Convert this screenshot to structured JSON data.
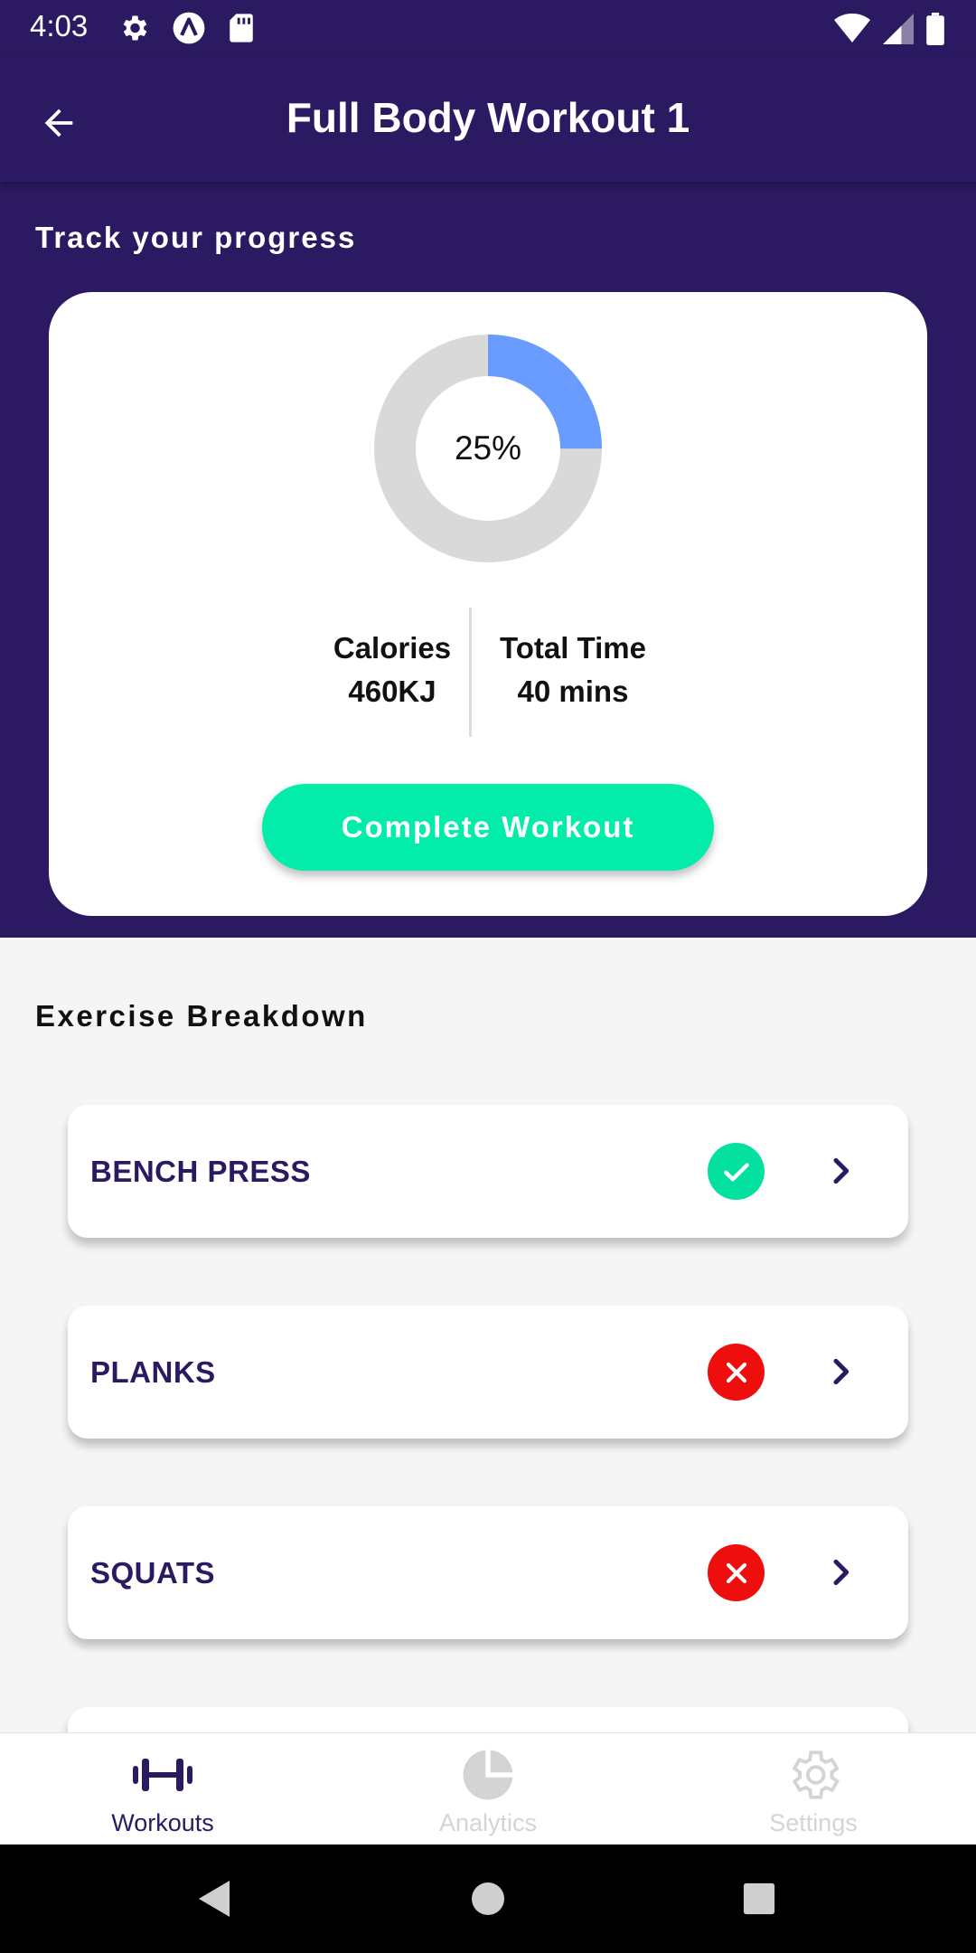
{
  "status_bar": {
    "time": "4:03",
    "left_icons": [
      "gear-icon",
      "a-icon",
      "sd-card-icon"
    ],
    "right_icons": [
      "wifi-icon",
      "cell-signal-icon",
      "battery-icon"
    ]
  },
  "app_bar": {
    "title": "Full Body Workout 1",
    "back_icon": "arrow-left-icon"
  },
  "progress": {
    "heading": "Track your progress",
    "percent_value": 0.25,
    "percent_label": "25%",
    "calories_label": "Calories",
    "calories_value": "460KJ",
    "time_label": "Total Time",
    "time_value": "40 mins",
    "complete_button_label": "Complete Workout"
  },
  "breakdown": {
    "heading": "Exercise Breakdown",
    "exercises": [
      {
        "name": "BENCH PRESS",
        "status": "done"
      },
      {
        "name": "PLANKS",
        "status": "not-done"
      },
      {
        "name": "SQUATS",
        "status": "not-done"
      }
    ]
  },
  "bottom_nav": {
    "items": [
      {
        "label": "Workouts",
        "icon": "dumbbell-icon",
        "active": true
      },
      {
        "label": "Analytics",
        "icon": "pie-chart-icon",
        "active": false
      },
      {
        "label": "Settings",
        "icon": "gear-icon",
        "active": false
      }
    ]
  },
  "colors": {
    "primary": "#2b1961",
    "accent": "#04eca9",
    "donut_fill": "#6a9cff",
    "donut_track": "#d9d9d9",
    "error": "#ee0e0e"
  }
}
